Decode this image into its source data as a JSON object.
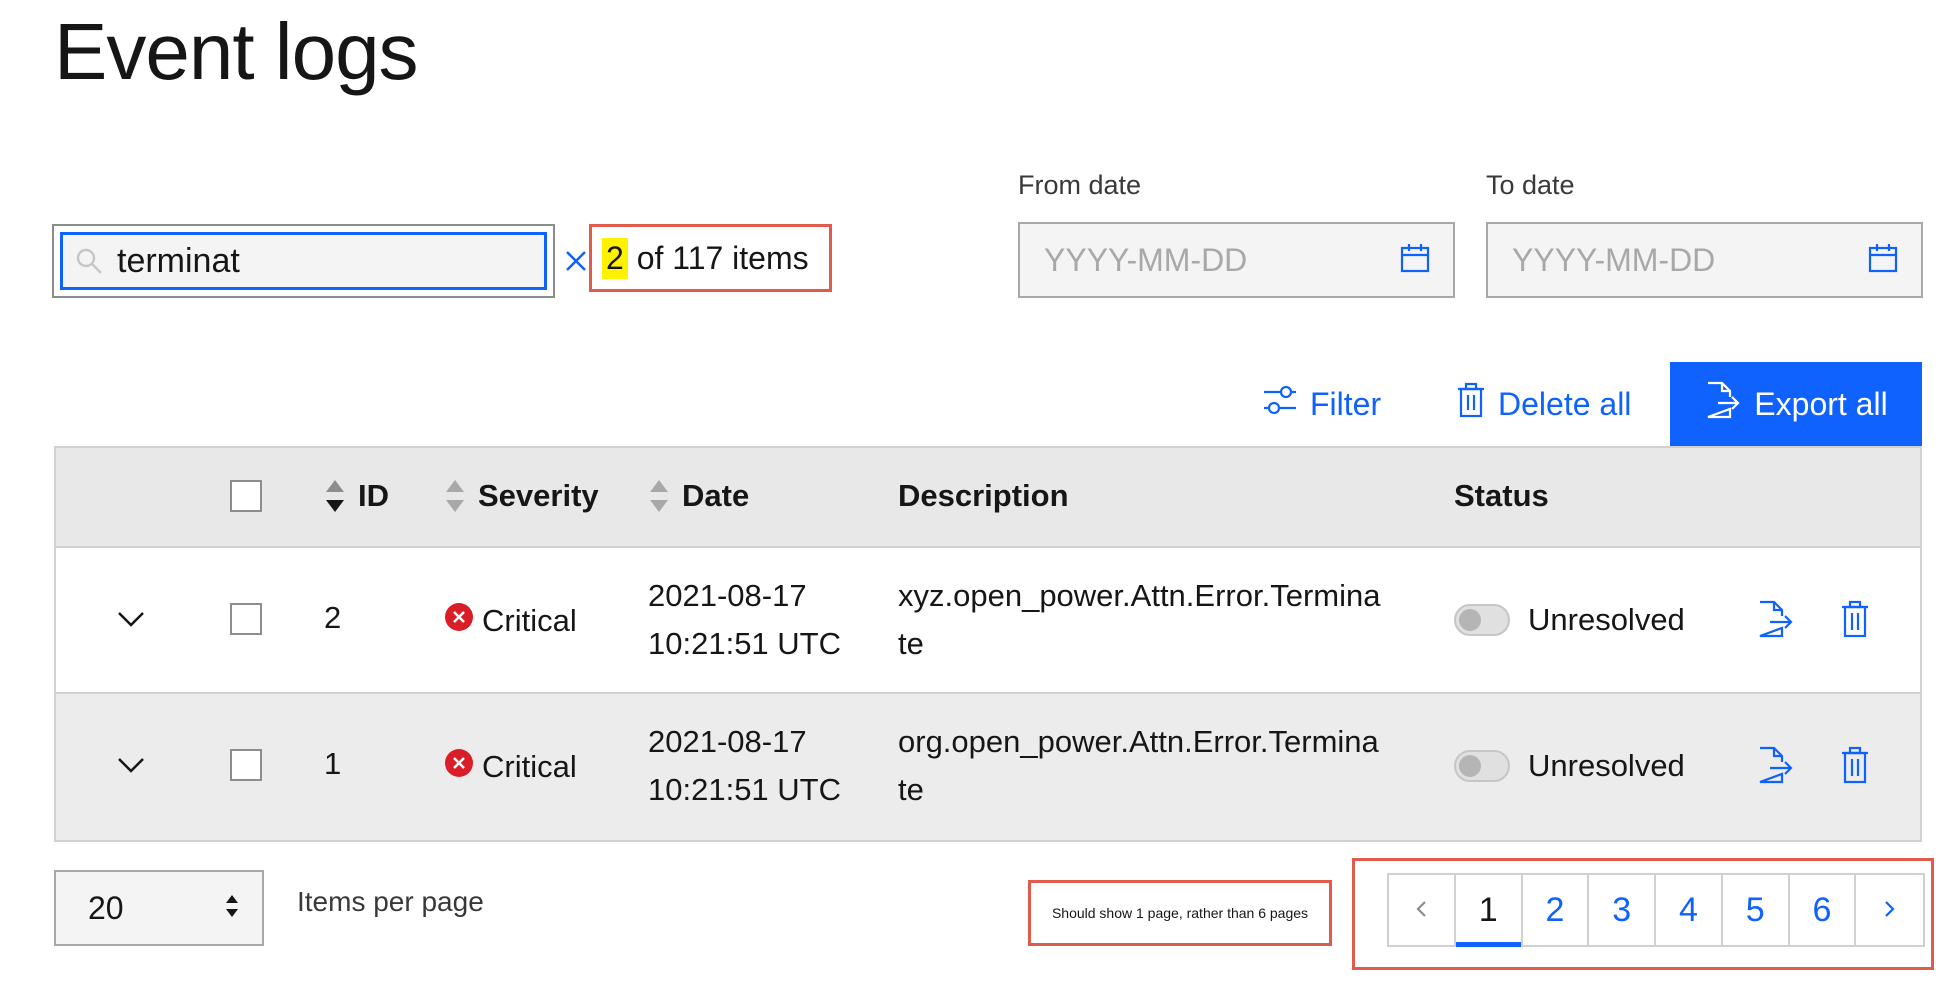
{
  "page": {
    "title": "Event logs"
  },
  "search": {
    "value": "terminat"
  },
  "results": {
    "highlight": "2",
    "rest": " of 117 items"
  },
  "dates": {
    "from_label": "From date",
    "to_label": "To date",
    "placeholder": "YYYY-MM-DD"
  },
  "toolbar": {
    "filter": "Filter",
    "delete_all": "Delete all",
    "export_all": "Export all"
  },
  "table": {
    "headers": {
      "id": "ID",
      "severity": "Severity",
      "date": "Date",
      "description": "Description",
      "status": "Status"
    },
    "rows": [
      {
        "id": "2",
        "severity": "Critical",
        "date_line1": "2021-08-17",
        "date_line2": "10:21:51 UTC",
        "desc_line1": "xyz.open_power.Attn.Error.Termina",
        "desc_line2": "te",
        "status": "Unresolved"
      },
      {
        "id": "1",
        "severity": "Critical",
        "date_line1": "2021-08-17",
        "date_line2": "10:21:51 UTC",
        "desc_line1": "org.open_power.Attn.Error.Termina",
        "desc_line2": "te",
        "status": "Unresolved"
      }
    ]
  },
  "pagination": {
    "per_page_value": "20",
    "per_page_label": "Items per page",
    "note": "Should show 1 page, rather than 6 pages",
    "pages": [
      "1",
      "2",
      "3",
      "4",
      "5",
      "6"
    ],
    "current": "1"
  },
  "colors": {
    "accent": "#0f62fe",
    "annotation": "#e05b4b",
    "critical": "#da1e28",
    "highlight": "#fff200"
  }
}
